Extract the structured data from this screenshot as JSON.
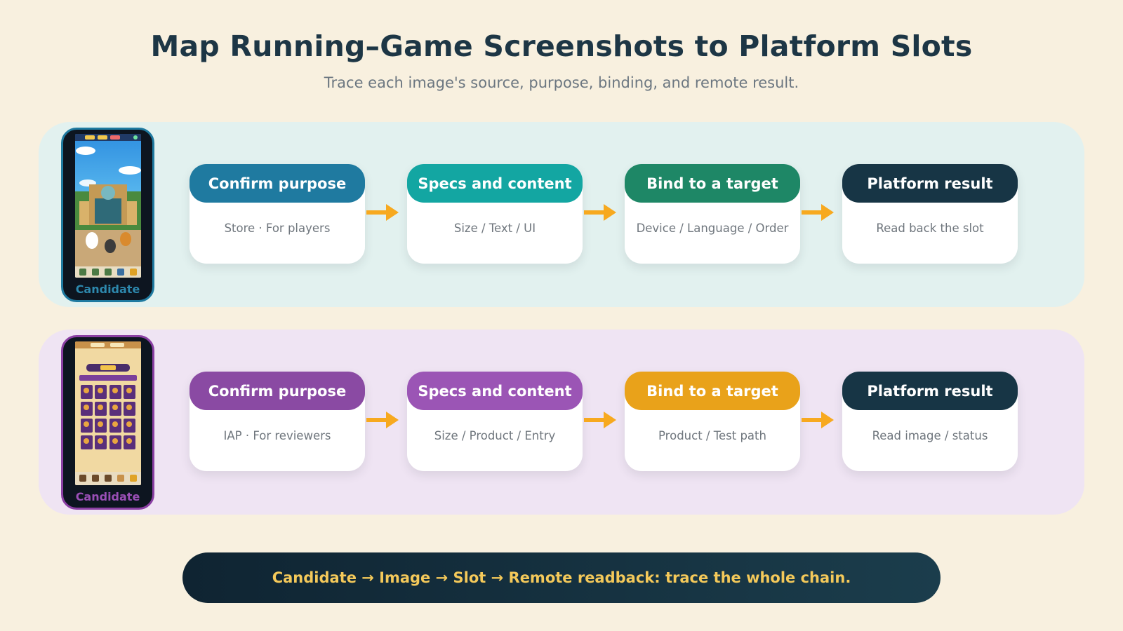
{
  "title": "Map Running–Game Screenshots to Platform Slots",
  "subtitle": "Trace each image's source, purpose, binding, and remote result.",
  "rows": [
    {
      "candidate_label": "Candidate",
      "steps": [
        {
          "title": "Confirm purpose",
          "text": "Store · For players",
          "color": "#1f7aa0"
        },
        {
          "title": "Specs and content",
          "text": "Size / Text / UI",
          "color": "#13a6a2"
        },
        {
          "title": "Bind to a target",
          "text": "Device / Language / Order",
          "color": "#1e8766"
        },
        {
          "title": "Platform result",
          "text": "Read back the slot",
          "color": "#173545"
        }
      ]
    },
    {
      "candidate_label": "Candidate",
      "steps": [
        {
          "title": "Confirm purpose",
          "text": "IAP · For reviewers",
          "color": "#8a4aa3"
        },
        {
          "title": "Specs and content",
          "text": "Size / Product / Entry",
          "color": "#9b55b5"
        },
        {
          "title": "Bind to a target",
          "text": "Product / Test path",
          "color": "#e9a21a"
        },
        {
          "title": "Platform result",
          "text": "Read image / status",
          "color": "#173545"
        }
      ]
    }
  ],
  "footer": "Candidate → Image → Slot → Remote readback: trace the whole chain.",
  "colors": {
    "background": "#f8f0df",
    "arrow": "#f7a91f",
    "row1_band": "#e2f1ef",
    "row2_band": "#efe4f3"
  },
  "icons": [
    "arrow-right-icon"
  ]
}
